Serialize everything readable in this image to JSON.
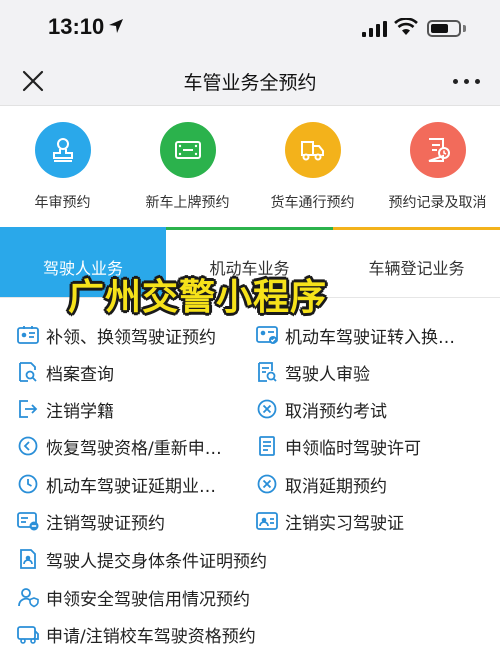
{
  "status_bar": {
    "time": "13:10"
  },
  "nav": {
    "title": "车管业务全预约"
  },
  "quick_actions": [
    {
      "label": "年审预约",
      "color": "#2aa8ea",
      "icon": "stamp-icon"
    },
    {
      "label": "新车上牌预约",
      "color": "#2bb24c",
      "icon": "license-plate-icon"
    },
    {
      "label": "货车通行预约",
      "color": "#f3b21b",
      "icon": "truck-icon"
    },
    {
      "label": "预约记录及取消",
      "color": "#f26b5b",
      "icon": "records-icon"
    }
  ],
  "tabs": [
    {
      "label": "驾驶人业务"
    },
    {
      "label": "机动车业务"
    },
    {
      "label": "车辆登记业务"
    }
  ],
  "overlay_text": "广州交警小程序",
  "services": [
    {
      "label": "补领、换领驾驶证预约",
      "icon": "id-card-icon"
    },
    {
      "label": "机动车驾驶证转入换…",
      "icon": "license-transfer-icon"
    },
    {
      "label": "档案查询",
      "icon": "file-search-icon"
    },
    {
      "label": "驾驶人审验",
      "icon": "review-icon"
    },
    {
      "label": "注销学籍",
      "icon": "exit-icon"
    },
    {
      "label": "取消预约考试",
      "icon": "cancel-circle-icon"
    },
    {
      "label": "恢复驾驶资格/重新申…",
      "icon": "restore-icon"
    },
    {
      "label": "申领临时驾驶许可",
      "icon": "document-icon"
    },
    {
      "label": "机动车驾驶证延期业…",
      "icon": "clock-icon"
    },
    {
      "label": "取消延期预约",
      "icon": "cancel-circle-icon"
    },
    {
      "label": "注销驾驶证预约",
      "icon": "card-minus-icon"
    },
    {
      "label": "注销实习驾驶证",
      "icon": "intern-card-icon"
    },
    {
      "label": "驾驶人提交身体条件证明预约",
      "icon": "health-doc-icon"
    },
    {
      "label": "申领安全驾驶信用情况预约",
      "icon": "user-shield-icon"
    },
    {
      "label": "申请/注销校车驾驶资格预约",
      "icon": "bus-icon"
    }
  ],
  "colors": {
    "icon_blue": "#2a8fd8",
    "tab_active": "#2aa8ea"
  }
}
